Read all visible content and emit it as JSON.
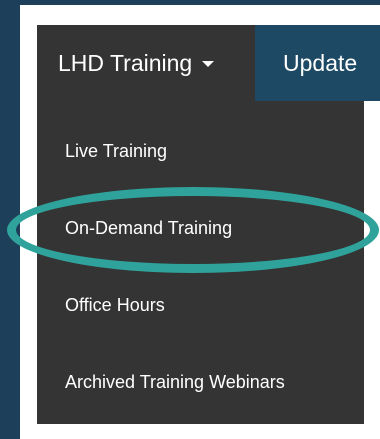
{
  "nav": {
    "active_label": "LHD Training",
    "next_label": "Update"
  },
  "dropdown": {
    "items": [
      {
        "label": "Live Training"
      },
      {
        "label": "On-Demand Training"
      },
      {
        "label": "Office Hours"
      },
      {
        "label": "Archived Training Webinars"
      }
    ]
  },
  "colors": {
    "page_background": "#1e3f5a",
    "menu_background": "#343434",
    "next_tab_background": "#1d4964",
    "highlight_ring": "#2fa39b"
  },
  "icons": {
    "dropdown_indicator": "caret-down-icon"
  }
}
